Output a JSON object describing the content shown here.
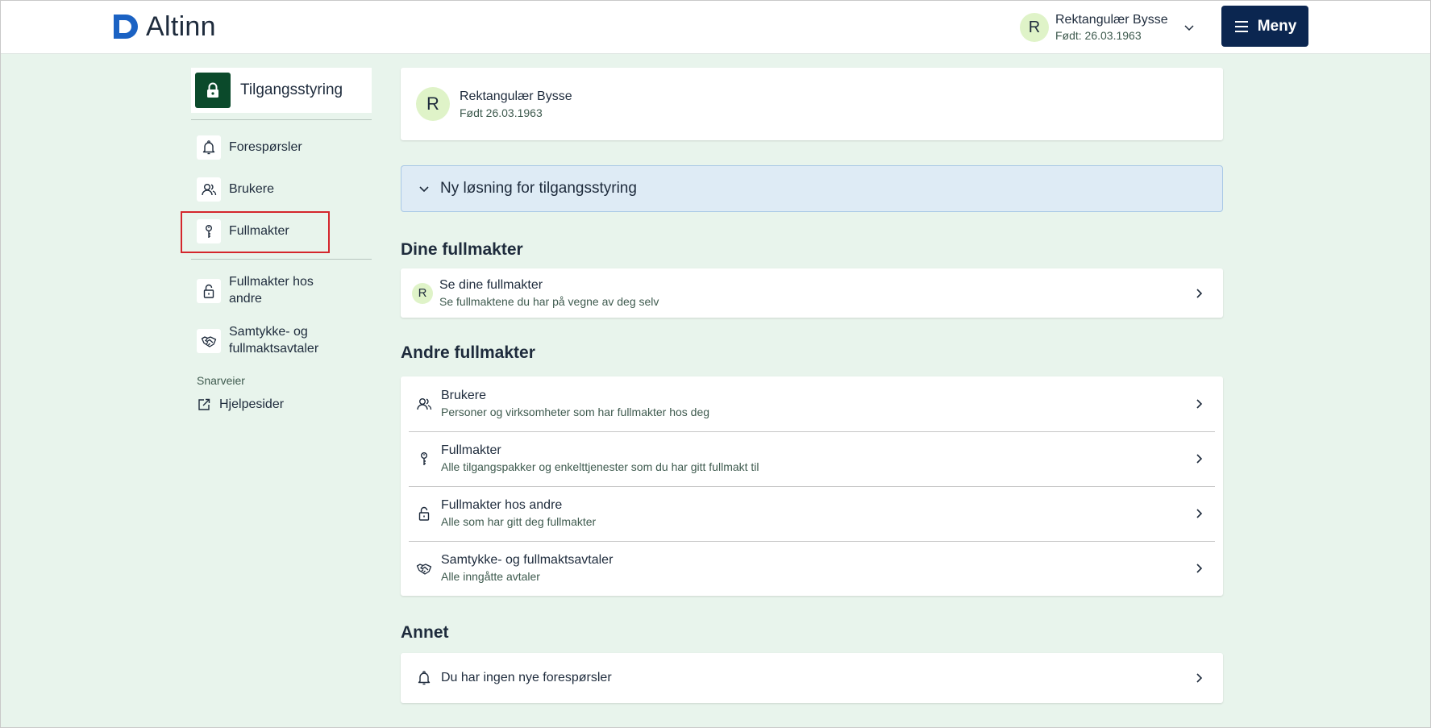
{
  "header": {
    "logo_text": "Altinn",
    "user": {
      "initial": "R",
      "name": "Rektangulær Bysse",
      "dob": "Født: 26.03.1963"
    },
    "menu_label": "Meny"
  },
  "sidebar": {
    "heading": "Tilgangsstyring",
    "items": [
      {
        "label": "Forespørsler",
        "icon": "bell-icon"
      },
      {
        "label": "Brukere",
        "icon": "users-icon"
      },
      {
        "label": "Fullmakter",
        "icon": "key-icon"
      },
      {
        "label": "Fullmakter hos andre",
        "icon": "padlock-icon"
      },
      {
        "label": "Samtykke- og fullmaktsavtaler",
        "icon": "handshake-icon"
      }
    ],
    "shortcuts_label": "Snarveier",
    "help_link": "Hjelpesider"
  },
  "profile": {
    "initial": "R",
    "name": "Rektangulær Bysse",
    "dob": "Født 26.03.1963"
  },
  "accordion": {
    "label": "Ny løsning for tilgangsstyring"
  },
  "dine": {
    "title": "Dine fullmakter",
    "item": {
      "initial": "R",
      "title": "Se dine fullmakter",
      "subtitle": "Se fullmaktene du har på vegne av deg selv"
    }
  },
  "andre": {
    "title": "Andre fullmakter",
    "items": [
      {
        "title": "Brukere",
        "subtitle": "Personer og virksomheter som har fullmakter hos deg",
        "icon": "users-icon"
      },
      {
        "title": "Fullmakter",
        "subtitle": "Alle tilgangspakker og enkelttjenester som du har gitt fullmakt til",
        "icon": "key-icon"
      },
      {
        "title": "Fullmakter hos andre",
        "subtitle": "Alle som har gitt deg fullmakter",
        "icon": "padlock-icon"
      },
      {
        "title": "Samtykke- og fullmaktsavtaler",
        "subtitle": "Alle inngåtte avtaler",
        "icon": "handshake-icon"
      }
    ]
  },
  "annet": {
    "title": "Annet",
    "item": {
      "title": "Du har ingen nye forespørsler",
      "icon": "bell-icon"
    }
  },
  "colors": {
    "page_bg": "#e8f4ec",
    "menu_button": "#0b2650",
    "sidebar_icon_bg": "#0b4a2b",
    "avatar_bg": "#dff3c8",
    "accordion_bg": "#deebf5",
    "highlight_border": "#d4262c",
    "logo_blue": "#1b62c3"
  }
}
